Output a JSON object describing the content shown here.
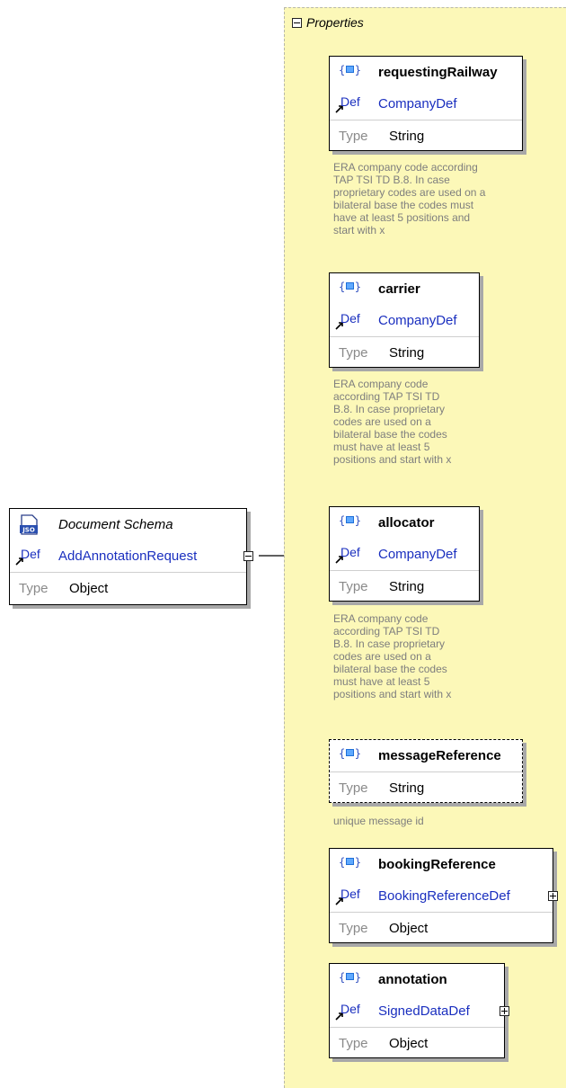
{
  "properties_panel": {
    "title": "Properties"
  },
  "root": {
    "title": "Document Schema",
    "def_label": "Def",
    "def": "AddAnnotationRequest",
    "type_label": "Type",
    "type": "Object",
    "icon": "json-document-icon"
  },
  "props": [
    {
      "name": "requestingRailway",
      "def_label": "Def",
      "def": "CompanyDef",
      "type_label": "Type",
      "type": "String",
      "description": "ERA company code according\nTAP TSI TD B.8. In case\nproprietary codes are used on a\nbilateral base the codes must\nhave at least 5 positions and\nstart with x"
    },
    {
      "name": "carrier",
      "def_label": "Def",
      "def": "CompanyDef",
      "type_label": "Type",
      "type": "String",
      "description": "ERA company code\naccording TAP TSI TD\nB.8. In case proprietary\ncodes are used on a\nbilateral base the codes\nmust have at least 5\npositions and start with x"
    },
    {
      "name": "allocator",
      "def_label": "Def",
      "def": "CompanyDef",
      "type_label": "Type",
      "type": "String",
      "description": "ERA company code\naccording TAP TSI TD\nB.8. In case proprietary\ncodes are used on a\nbilateral base the codes\nmust have at least 5\npositions and start with x"
    },
    {
      "name": "messageReference",
      "type_label": "Type",
      "type": "String",
      "description": "unique message id"
    },
    {
      "name": "bookingReference",
      "def_label": "Def",
      "def": "BookingReferenceDef",
      "type_label": "Type",
      "type": "Object"
    },
    {
      "name": "annotation",
      "def_label": "Def",
      "def": "SignedDataDef",
      "type_label": "Type",
      "type": "Object"
    }
  ],
  "icons": {
    "property": "property-icon",
    "def_arrow": "reference-arrow-icon",
    "collapse": "collapse-icon",
    "expand": "expand-icon"
  }
}
